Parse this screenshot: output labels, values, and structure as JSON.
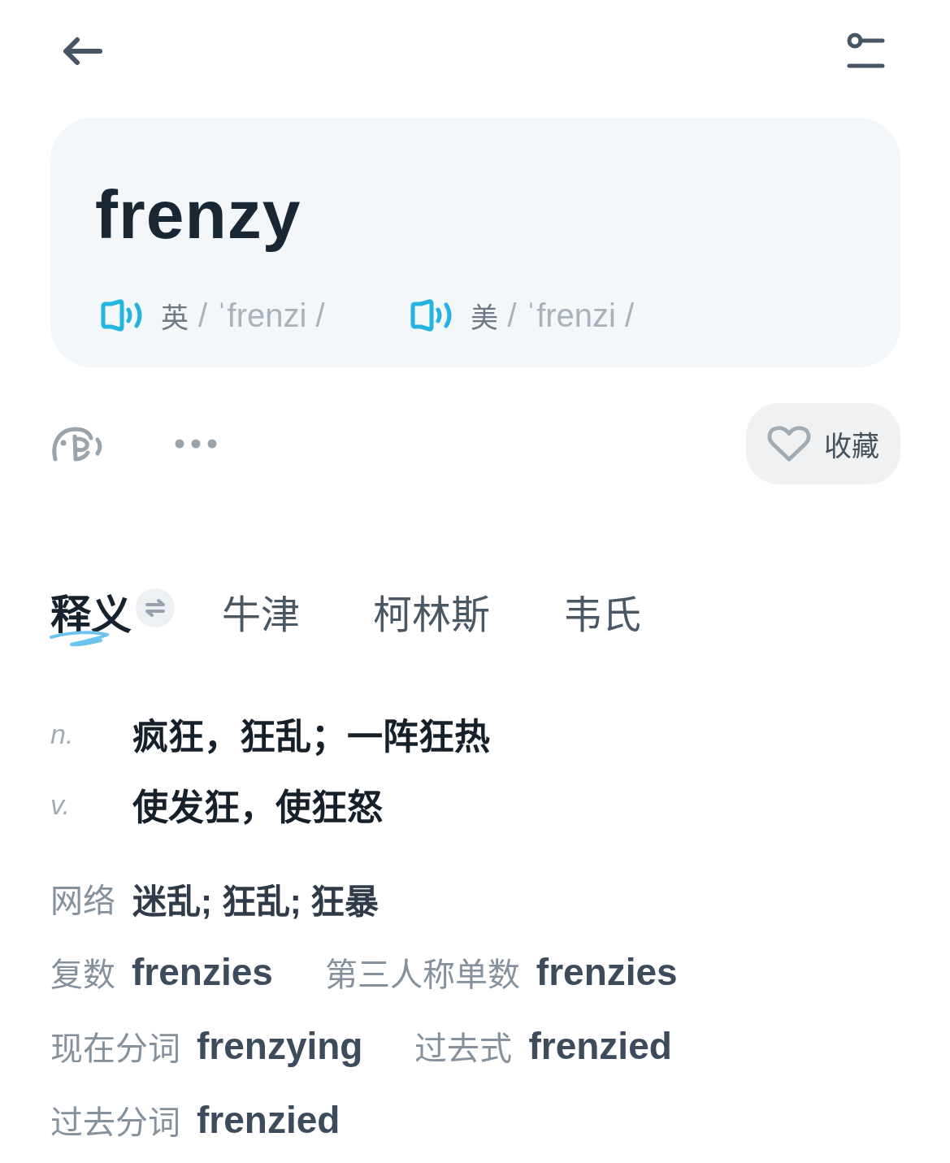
{
  "word_card": {
    "word": "frenzy",
    "pronunciations": [
      {
        "region": "英",
        "phonetic": "/ ˈfrenzi /"
      },
      {
        "region": "美",
        "phonetic": "/ ˈfrenzi /"
      }
    ]
  },
  "actions": {
    "collect_button": {
      "label": "收藏",
      "collected": false
    }
  },
  "tabs": [
    {
      "label": "释义",
      "selected": true
    },
    {
      "label": "牛津",
      "selected": false
    },
    {
      "label": "柯林斯",
      "selected": false
    },
    {
      "label": "韦氏",
      "selected": false
    }
  ],
  "definitions": [
    {
      "pos": "n.",
      "text": "疯狂，狂乱；一阵狂热"
    },
    {
      "pos": "v.",
      "text": "使发狂，使狂怒"
    }
  ],
  "web_definition": {
    "label": "网络",
    "text": "迷乱; 狂乱; 狂暴"
  },
  "word_forms": [
    {
      "items": [
        {
          "label": "复数",
          "value": "frenzies"
        },
        {
          "label": "第三人称单数",
          "value": "frenzies"
        }
      ]
    },
    {
      "items": [
        {
          "label": "现在分词",
          "value": "frenzying"
        },
        {
          "label": "过去式",
          "value": "frenzied"
        }
      ]
    },
    {
      "items": [
        {
          "label": "过去分词",
          "value": "frenzied"
        }
      ]
    }
  ]
}
